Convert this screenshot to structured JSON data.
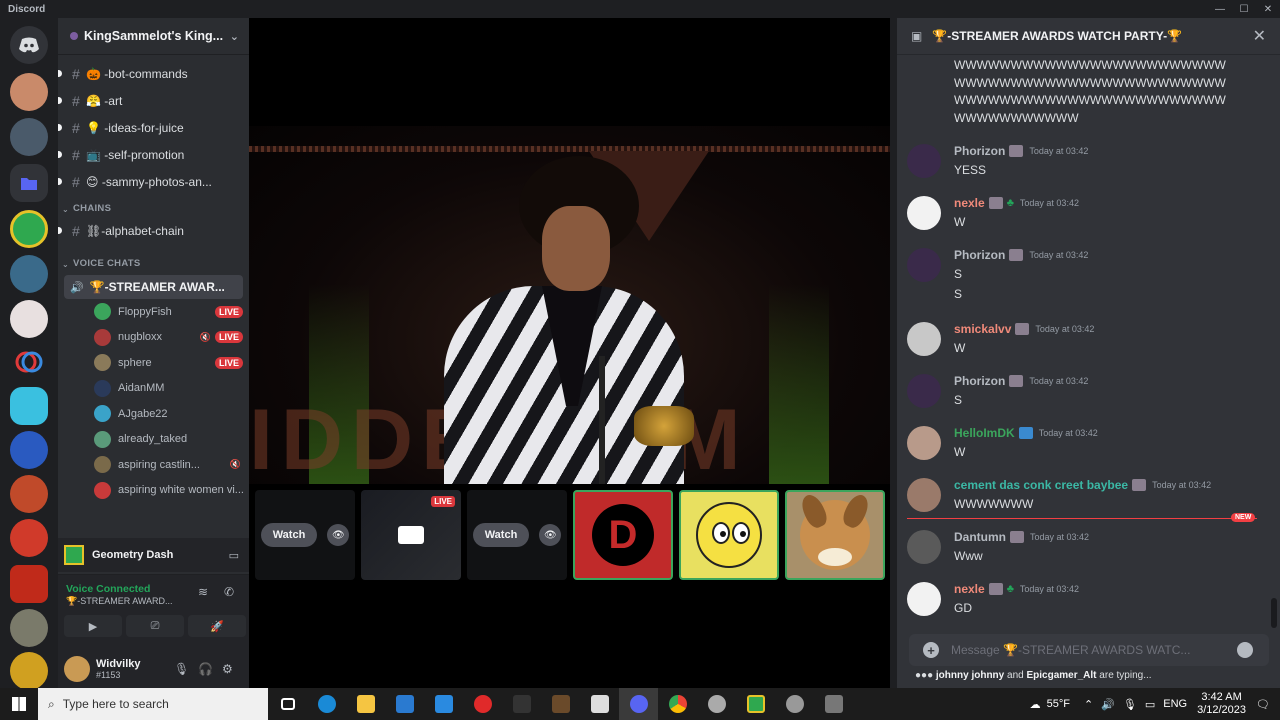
{
  "app": {
    "title": "Discord"
  },
  "server": {
    "name": "KingSammelot's King..."
  },
  "channels": [
    {
      "emoji": "🎃",
      "name": "-bot-commands"
    },
    {
      "emoji": "😤",
      "name": "-art"
    },
    {
      "emoji": "💡",
      "name": "-ideas-for-juice"
    },
    {
      "emoji": "📺",
      "name": "-self-promotion"
    },
    {
      "emoji": "😊",
      "name": "-sammy-photos-an..."
    }
  ],
  "categories": {
    "chains": "CHAINS",
    "voice": "VOICE CHATS"
  },
  "chain_channel": {
    "name": "⛓-alphabet-chain"
  },
  "voice_channel": {
    "name": "🏆-STREAMER AWAR..."
  },
  "voice_users": [
    {
      "name": "FloppyFish",
      "live": "LIVE",
      "color": "#3ba55c"
    },
    {
      "name": "nugbloxx",
      "live": "LIVE",
      "color": "#a83a3a"
    },
    {
      "name": "sphere",
      "live": "LIVE",
      "color": "#8a7a5a"
    },
    {
      "name": "AidanMM",
      "live": "",
      "color": "#2a3a5a"
    },
    {
      "name": "AJgabe22",
      "live": "",
      "color": "#3aa3c9"
    },
    {
      "name": "already_taked",
      "live": "",
      "color": "#5a9a7a"
    },
    {
      "name": "aspiring castlin...",
      "live": "",
      "color": "#7a6a4a"
    },
    {
      "name": "aspiring white women vi...",
      "live": "",
      "color": "#c83a3a"
    }
  ],
  "game": {
    "name": "Geometry Dash"
  },
  "voice": {
    "status": "Voice Connected",
    "channel": "🏆-STREAMER AWARD..."
  },
  "user": {
    "name": "Widvilky",
    "tag": "#1153"
  },
  "thumbnails": {
    "watch": "Watch",
    "live": "LIVE",
    "d_letter": "D"
  },
  "chat": {
    "title": "🏆-STREAMER AWARDS WATCH PARTY-🏆",
    "wall": [
      "WWWWWWWWWWWWWWWWWWWWWWWW",
      "WWWWWWWWWWWWWWWWWWWWWWWW",
      "WWWWWWWWWWWWWWWWWWWWWWWW",
      "WWWWWWWWWWW"
    ],
    "messages": [
      {
        "author": "Phorizon",
        "color": "#b5bac1",
        "time": "Today at 03:42",
        "lines": [
          "YESS"
        ],
        "av": "#3a2a4a"
      },
      {
        "author": "nexle",
        "color": "#f08a7a",
        "time": "Today at 03:42",
        "lines": [
          "W"
        ],
        "av": "#f2f2f2"
      },
      {
        "author": "Phorizon",
        "color": "#b5bac1",
        "time": "Today at 03:42",
        "lines": [
          "S",
          "S"
        ],
        "av": "#3a2a4a"
      },
      {
        "author": "smickalvv",
        "color": "#f08a7a",
        "time": "Today at 03:42",
        "lines": [
          "W"
        ],
        "av": "#c8c8c8"
      },
      {
        "author": "Phorizon",
        "color": "#b5bac1",
        "time": "Today at 03:42",
        "lines": [
          "S"
        ],
        "av": "#3a2a4a"
      },
      {
        "author": "HelloImDK",
        "color": "#3ba55c",
        "time": "Today at 03:42",
        "lines": [
          "W"
        ],
        "av": "#b89a8a"
      },
      {
        "author": "cement das conk creet baybee",
        "color": "#3bb8a5",
        "time": "Today at 03:42",
        "lines": [
          "WWWWWWW"
        ],
        "av": "#9a7a6a"
      },
      {
        "author": "Dantumn",
        "color": "#b5bac1",
        "time": "Today at 03:42",
        "lines": [
          "Www"
        ],
        "av": "#5a5a5a"
      },
      {
        "author": "nexle",
        "color": "#f08a7a",
        "time": "Today at 03:42",
        "lines": [
          "GD"
        ],
        "av": "#f2f2f2"
      }
    ],
    "new_tag": "NEW",
    "placeholder": "Message 🏆-STREAMER AWARDS WATC...",
    "typing_users": "johnny johnny",
    "typing_and": "and",
    "typing_user2": "Epicgamer_Alt",
    "typing_suffix": "are typing..."
  },
  "taskbar": {
    "search_placeholder": "Type here to search",
    "weather": "55°F",
    "lang": "ENG",
    "time": "3:42 AM",
    "date": "3/12/2023"
  }
}
